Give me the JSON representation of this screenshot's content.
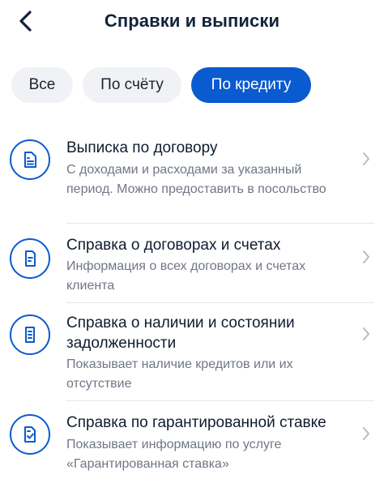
{
  "header": {
    "back_icon": "chevron-left-icon",
    "title": "Справки и выписки"
  },
  "tabs": [
    {
      "label": "Все",
      "active": false
    },
    {
      "label": "По счёту",
      "active": false
    },
    {
      "label": "По кредиту",
      "active": true
    }
  ],
  "items": [
    {
      "title": "Выписка по договору",
      "description": "С доходами и расходами за указанный период. Можно предоставить в посольство",
      "icon": "statement-document-icon"
    },
    {
      "title": "Справка о договорах и счетах",
      "description": "Информация о всех договорах и счетах клиента",
      "icon": "document-icon"
    },
    {
      "title": "Справка о наличии и состоянии задолженности",
      "description": "Показывает наличие кредитов или их отсутствие",
      "icon": "receipt-icon"
    },
    {
      "title": "Справка по гарантированной ставке",
      "description": "Показывает информацию по услуге «Гарантированная ставка»",
      "icon": "document-check-icon"
    }
  ],
  "colors": {
    "accent": "#0a5ad0",
    "tab_inactive_bg": "#f0f2f5",
    "secondary_text": "#6f7785"
  }
}
